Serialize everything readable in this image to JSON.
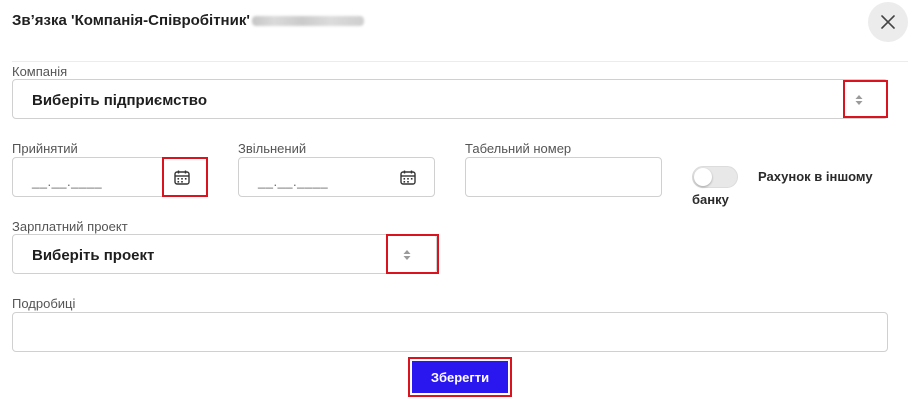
{
  "dialog": {
    "title": "Зв’язка 'Компанія-Співробітник'"
  },
  "fields": {
    "company": {
      "label": "Компанія",
      "value": "Виберіть підприємство"
    },
    "hired": {
      "label": "Прийнятий",
      "placeholder": "__.__.____"
    },
    "fired": {
      "label": "Звільнений",
      "placeholder": "__.__.____"
    },
    "personnel_number": {
      "label": "Табельний номер",
      "value": ""
    },
    "other_bank": {
      "label_line1": "Рахунок в іншому",
      "label_line2": "банку",
      "checked": false
    },
    "salary_project": {
      "label": "Зарплатний проект",
      "value": "Виберіть проект"
    },
    "details": {
      "label": "Подробиці",
      "value": ""
    }
  },
  "actions": {
    "save_label": "Зберегти"
  },
  "colors": {
    "primary_button": "#2a17f0",
    "highlight_border": "#d9141e"
  }
}
